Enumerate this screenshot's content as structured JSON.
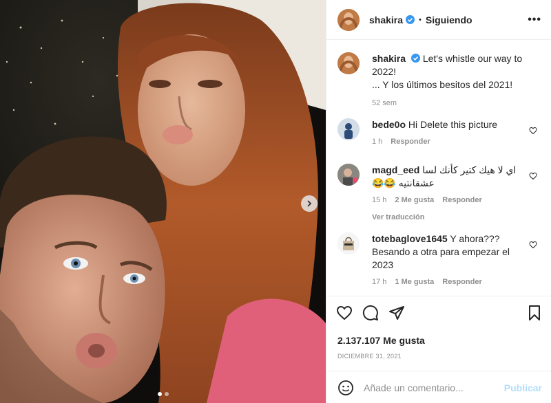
{
  "post_header": {
    "username": "shakira",
    "separator": "•",
    "follow_status": "Siguiendo",
    "more_label": "•••"
  },
  "caption": {
    "username": "shakira",
    "line1": "Let's whistle our way to 2022!",
    "line2": "... Y los últimos besitos del 2021!",
    "age": "52 sem"
  },
  "comments": [
    {
      "username": "bede0o",
      "text": "Hi Delete this picture",
      "time": "1 h",
      "likes": "",
      "reply": "Responder",
      "translate": ""
    },
    {
      "username": "magd_eed",
      "text": "اي لا هيك كتير كأنك لسا عشقانتيه 😂😂",
      "time": "15 h",
      "likes": "2 Me gusta",
      "reply": "Responder",
      "translate": "Ver traducción"
    },
    {
      "username": "totebaglove1645",
      "text": "Y ahora??? Besando a otra para empezar el 2023",
      "time": "17 h",
      "likes": "1 Me gusta",
      "reply": "Responder",
      "translate": ""
    }
  ],
  "stats": {
    "likes": "2.137.107 Me gusta",
    "date": "DICIEMBRE 31, 2021"
  },
  "add_comment": {
    "placeholder": "Añade un comentario...",
    "publish": "Publicar"
  },
  "carousel": {
    "total": 2,
    "current": 1
  },
  "colors": {
    "verified": "#3897f0",
    "publish_disabled": "#b2dffc",
    "muted_text": "#8e8e8e"
  }
}
